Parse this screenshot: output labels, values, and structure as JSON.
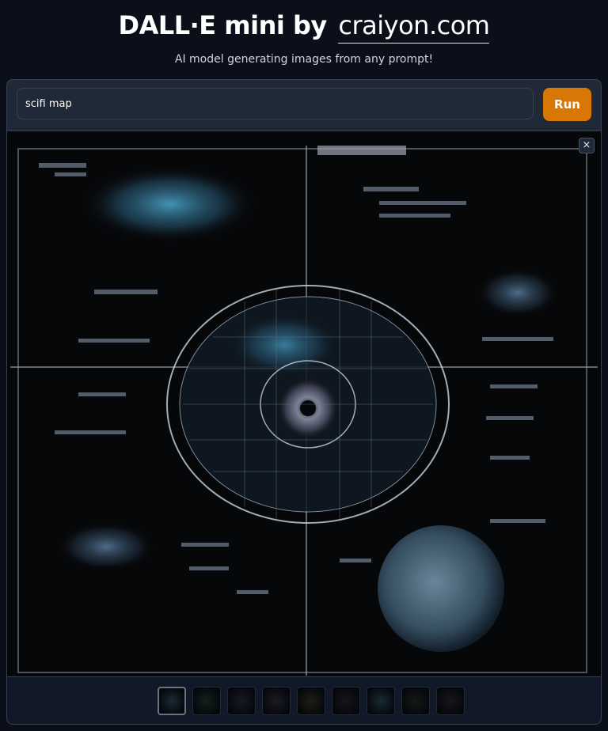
{
  "header": {
    "title": "DALL·E mini by",
    "site": "craiyon.com",
    "subtitle": "AI model generating images from any prompt!"
  },
  "prompt": {
    "value": "scifi map",
    "placeholder": "",
    "run_label": "Run"
  },
  "gallery": {
    "close_label": "×",
    "selected_index": 0,
    "thumbnail_count": 9
  },
  "colors": {
    "background": "#0b0f19",
    "panel": "#1f2937",
    "accent": "#d97706"
  }
}
